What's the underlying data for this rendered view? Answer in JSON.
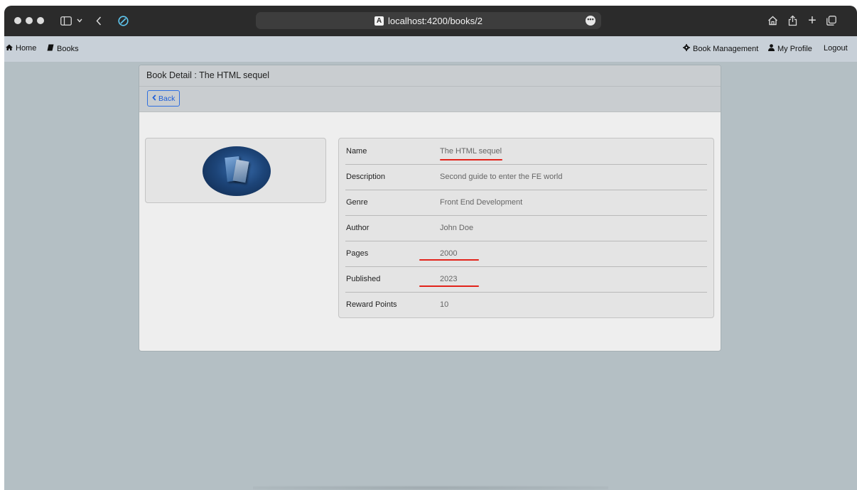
{
  "browser": {
    "url": "localhost:4200/books/2",
    "url_badge": "A"
  },
  "navbar": {
    "home": "Home",
    "books": "Books",
    "book_management": "Book Management",
    "my_profile": "My Profile",
    "logout": "Logout"
  },
  "card": {
    "header": "Book Detail : The HTML sequel",
    "back_label": "Back"
  },
  "details": [
    {
      "label": "Name",
      "value": "The HTML sequel"
    },
    {
      "label": "Description",
      "value": "Second guide to enter the FE world"
    },
    {
      "label": "Genre",
      "value": "Front End Development"
    },
    {
      "label": "Author",
      "value": "John Doe"
    },
    {
      "label": "Pages",
      "value": "2000"
    },
    {
      "label": "Published",
      "value": "2023"
    },
    {
      "label": "Reward Points",
      "value": "10"
    }
  ],
  "colors": {
    "accent": "#1f5fd8",
    "annotation": "#e2231a",
    "background": "#b4bfc4"
  }
}
